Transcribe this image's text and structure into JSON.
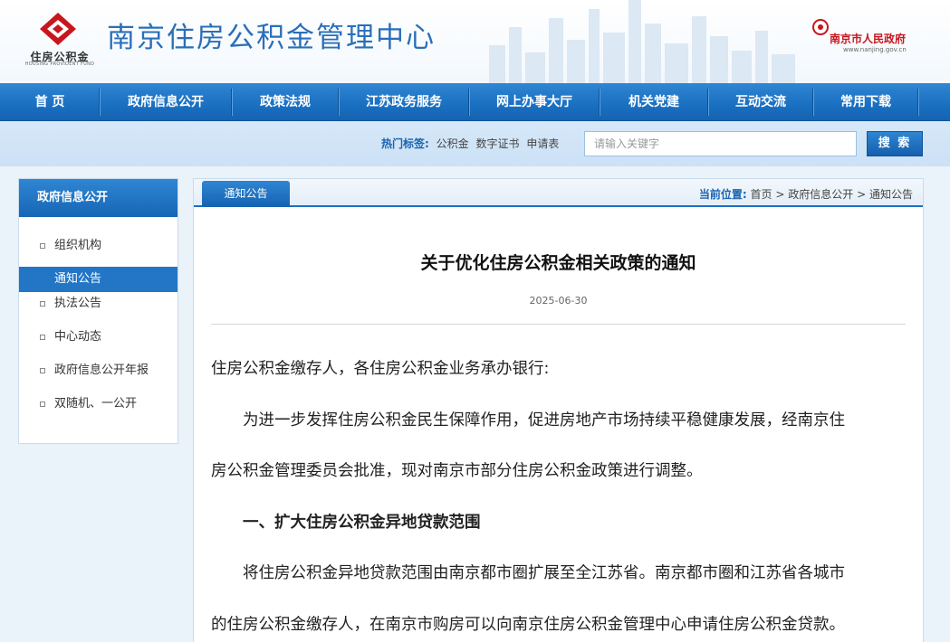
{
  "header": {
    "logo_text": "住房公积金",
    "logo_subtext": "HOUSING PROVIDENT FUND",
    "site_title": "南京住房公积金管理中心",
    "gov_name": "南京市人民政府",
    "gov_url": "www.nanjing.gov.cn",
    "brand_color": "#c8161d",
    "title_color": "#2a6fb8"
  },
  "nav": {
    "items": [
      {
        "label": "首 页"
      },
      {
        "label": "政府信息公开"
      },
      {
        "label": "政策法规"
      },
      {
        "label": "江苏政务服务"
      },
      {
        "label": "网上办事大厅"
      },
      {
        "label": "机关党建"
      },
      {
        "label": "互动交流"
      },
      {
        "label": "常用下载"
      }
    ],
    "color": "#1a6fc1"
  },
  "search": {
    "hot_label": "热门标签:",
    "hot_tags": [
      "公积金",
      "数字证书",
      "申请表"
    ],
    "placeholder": "请输入关键字",
    "button_label": "搜 索"
  },
  "sidebar": {
    "title": "政府信息公开",
    "items": [
      {
        "label": "组织机构",
        "active": false
      },
      {
        "label": "通知公告",
        "active": true
      },
      {
        "label": "执法公告",
        "active": false
      },
      {
        "label": "中心动态",
        "active": false
      },
      {
        "label": "政府信息公开年报",
        "active": false
      },
      {
        "label": "双随机、一公开",
        "active": false
      }
    ]
  },
  "main": {
    "tab_label": "通知公告",
    "breadcrumb": {
      "label": "当前位置:",
      "items": [
        "首页",
        "政府信息公开",
        "通知公告"
      ],
      "separator": ">"
    },
    "article": {
      "title": "关于优化住房公积金相关政策的通知",
      "date": "2025-06-30",
      "paragraphs": [
        {
          "text": "住房公积金缴存人，各住房公积金业务承办银行:",
          "bold": false
        },
        {
          "text": "　　为进一步发挥住房公积金民生保障作用，促进房地产市场持续平稳健康发展，经南京住",
          "bold": false
        },
        {
          "text": "房公积金管理委员会批准，现对南京市部分住房公积金政策进行调整。",
          "bold": false
        },
        {
          "text": "　　一、扩大住房公积金异地贷款范围",
          "bold": true
        },
        {
          "text": "　　将住房公积金异地贷款范围由南京都市圈扩展至全江苏省。南京都市圈和江苏省各城市",
          "bold": false
        },
        {
          "text": "的住房公积金缴存人，在南京市购房可以向南京住房公积金管理中心申请住房公积金贷款。",
          "bold": false
        }
      ]
    }
  }
}
